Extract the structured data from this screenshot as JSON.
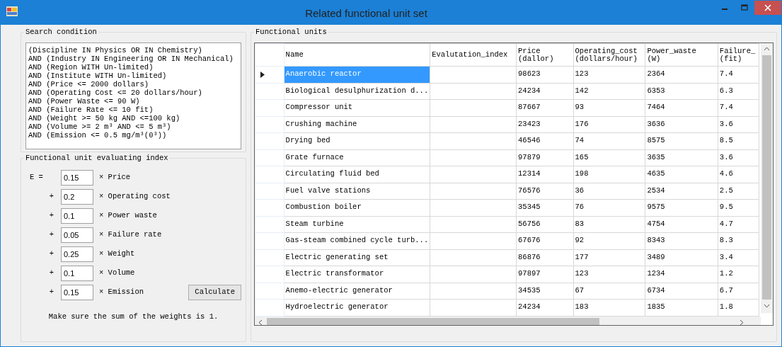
{
  "window": {
    "title": "Related functional unit set"
  },
  "search_condition": {
    "title": "Search condition",
    "lines": [
      "(Discipline IN Physics OR IN Chemistry)",
      "AND (Industry IN Engineering OR IN Mechanical)",
      "AND (Region WITH Un-limited)",
      "AND (Institute WITH Un-limited)",
      "AND (Price <= 2000 dollars)",
      "AND (Operating Cost <= 20 dollars/hour)",
      "AND (Power Waste <= 90 W)",
      "AND (Failure Rate <= 10 fit)",
      "AND (Weight >= 50 kg AND <=100 kg)",
      "AND (Volume >= 2 m³ AND <= 5 m³)",
      "AND (Emission <= 0.5 mg/m³(0³))"
    ]
  },
  "evaluating_index": {
    "title": "Functional unit evaluating index",
    "terms": [
      {
        "operator": "E =",
        "value": "0.15",
        "label": "× Price"
      },
      {
        "operator": "+",
        "value": "0.2",
        "label": "× Operating cost"
      },
      {
        "operator": "+",
        "value": "0.1",
        "label": "× Power waste"
      },
      {
        "operator": "+",
        "value": "0.05",
        "label": "× Failure rate"
      },
      {
        "operator": "+",
        "value": "0.25",
        "label": "× Weight"
      },
      {
        "operator": "+",
        "value": "0.1",
        "label": "× Volume"
      },
      {
        "operator": "+",
        "value": "0.15",
        "label": "× Emission"
      }
    ],
    "button": "Calculate",
    "note": "Make sure the sum of the weights is 1."
  },
  "functional_units": {
    "title": "Functional units",
    "columns": [
      "Name",
      "Evalutation_index",
      "Price\n(dallor)",
      "Operating_cost\n(dollars/hour)",
      "Power_waste\n(W)",
      "Failure_\n(fit)"
    ],
    "rows": [
      {
        "selected": true,
        "cells": [
          "Anaerobic reactor",
          "",
          "98623",
          "123",
          "2364",
          "7.4"
        ]
      },
      {
        "selected": false,
        "cells": [
          "Biological desulphurization d...",
          "",
          "24234",
          "142",
          "6353",
          "6.3"
        ]
      },
      {
        "selected": false,
        "cells": [
          "Compressor unit",
          "",
          "87667",
          "93",
          "7464",
          "7.4"
        ]
      },
      {
        "selected": false,
        "cells": [
          "Crushing machine",
          "",
          "23423",
          "176",
          "3636",
          "3.6"
        ]
      },
      {
        "selected": false,
        "cells": [
          "Drying bed",
          "",
          "46546",
          "74",
          "8575",
          "8.5"
        ]
      },
      {
        "selected": false,
        "cells": [
          "Grate furnace",
          "",
          "97879",
          "165",
          "3635",
          "3.6"
        ]
      },
      {
        "selected": false,
        "cells": [
          "Circulating fluid bed",
          "",
          "12314",
          "198",
          "4635",
          "4.6"
        ]
      },
      {
        "selected": false,
        "cells": [
          "Fuel valve stations",
          "",
          "76576",
          "36",
          "2534",
          "2.5"
        ]
      },
      {
        "selected": false,
        "cells": [
          "Combustion boiler",
          "",
          "35345",
          "76",
          "9575",
          "9.5"
        ]
      },
      {
        "selected": false,
        "cells": [
          "Steam turbine",
          "",
          "56756",
          "83",
          "4754",
          "4.7"
        ]
      },
      {
        "selected": false,
        "cells": [
          "Gas-steam combined cycle turb...",
          "",
          "67676",
          "92",
          "8343",
          "8.3"
        ]
      },
      {
        "selected": false,
        "cells": [
          "Electric generating set",
          "",
          "86876",
          "177",
          "3489",
          "3.4"
        ]
      },
      {
        "selected": false,
        "cells": [
          "Electric transformator",
          "",
          "97897",
          "123",
          "1234",
          "1.2"
        ]
      },
      {
        "selected": false,
        "cells": [
          "Anemo-electric generator",
          "",
          "34535",
          "67",
          "6734",
          "6.7"
        ]
      },
      {
        "selected": false,
        "cells": [
          "Hydroelectric generator",
          "",
          "24234",
          "183",
          "1835",
          "1.8"
        ]
      }
    ]
  }
}
